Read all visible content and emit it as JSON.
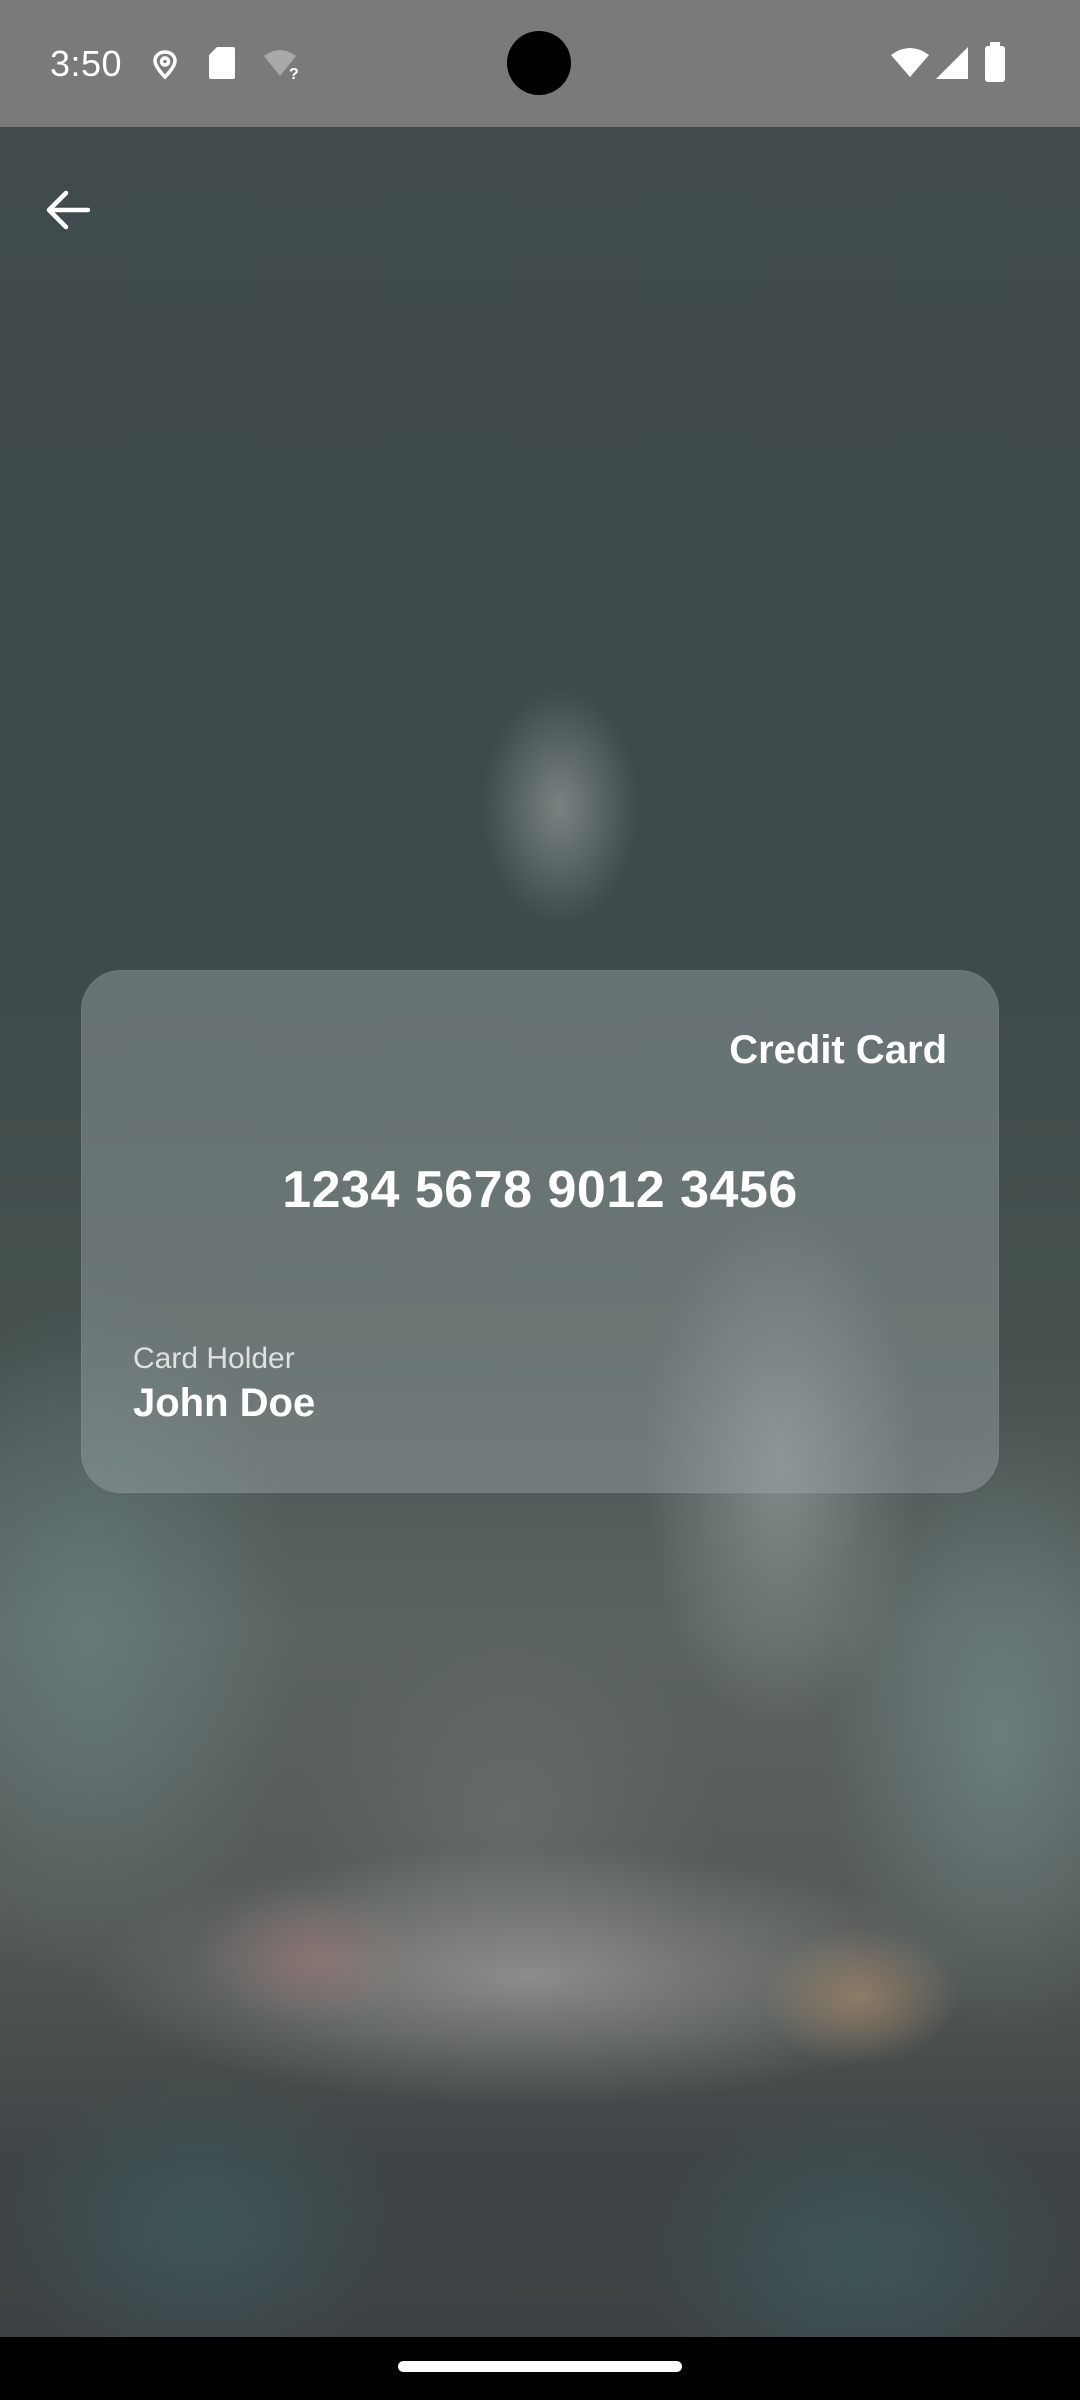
{
  "status_bar": {
    "time": "3:50",
    "left_icons": [
      "location-pin-icon",
      "sd-card-icon",
      "wifi-unknown-icon"
    ],
    "right_icons": [
      "wifi-icon",
      "cellular-signal-icon",
      "battery-icon"
    ]
  },
  "toolbar": {
    "back_icon": "arrow-back-icon"
  },
  "card": {
    "type_label": "Credit Card",
    "number": "1234 5678 9012 3456",
    "holder_label": "Card Holder",
    "holder_name": "John Doe"
  },
  "colors": {
    "status_bar_bg": "#7a7a7a",
    "background": "#3e474a",
    "card_tint": "#a0aaac",
    "text": "#ffffff"
  }
}
